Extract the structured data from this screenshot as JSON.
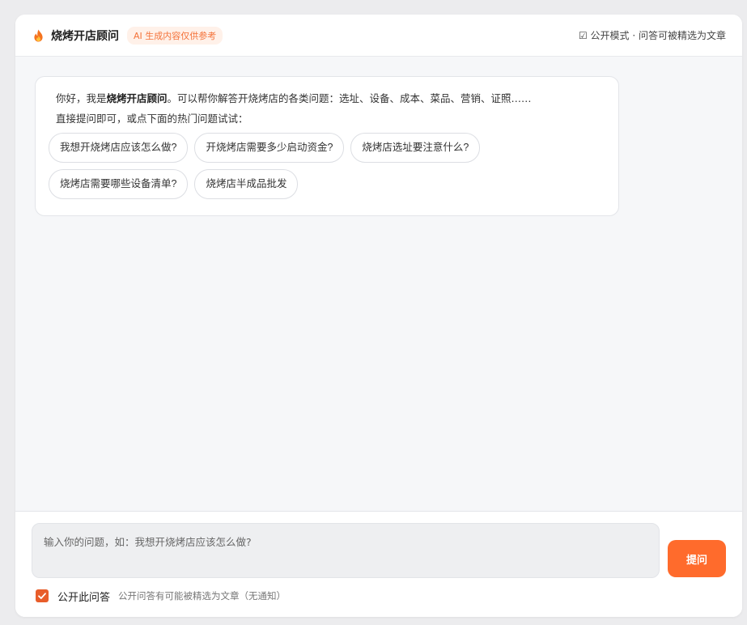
{
  "header": {
    "title": "烧烤开店顾问",
    "ai_badge": "AI 生成内容仅供参考",
    "mode_hint": "☑ 公开模式 · 问答可被精选为文章",
    "logo_icon": "fire-icon",
    "accent_color": "#ff6b2c"
  },
  "welcome": {
    "intro_prefix": "你好，我是",
    "intro_name": "烧烤开店顾问",
    "intro_suffix": "。可以帮你解答开烧烤店的各类问题：选址、设备、成本、菜品、营销、证照……",
    "hint": "直接提问即可，或点下面的热门问题试试：",
    "suggestions": [
      "我想开烧烤店应该怎么做?",
      "开烧烤店需要多少启动资金?",
      "烧烤店选址要注意什么?",
      "烧烤店需要哪些设备清单?",
      "烧烤店半成品批发"
    ]
  },
  "composer": {
    "placeholder": "输入你的问题，如：我想开烧烤店应该怎么做?",
    "value": "",
    "ask_label": "提问",
    "public_checked": true,
    "public_label": "公开此问答",
    "public_note": "公开问答有可能被精选为文章（无通知）"
  }
}
